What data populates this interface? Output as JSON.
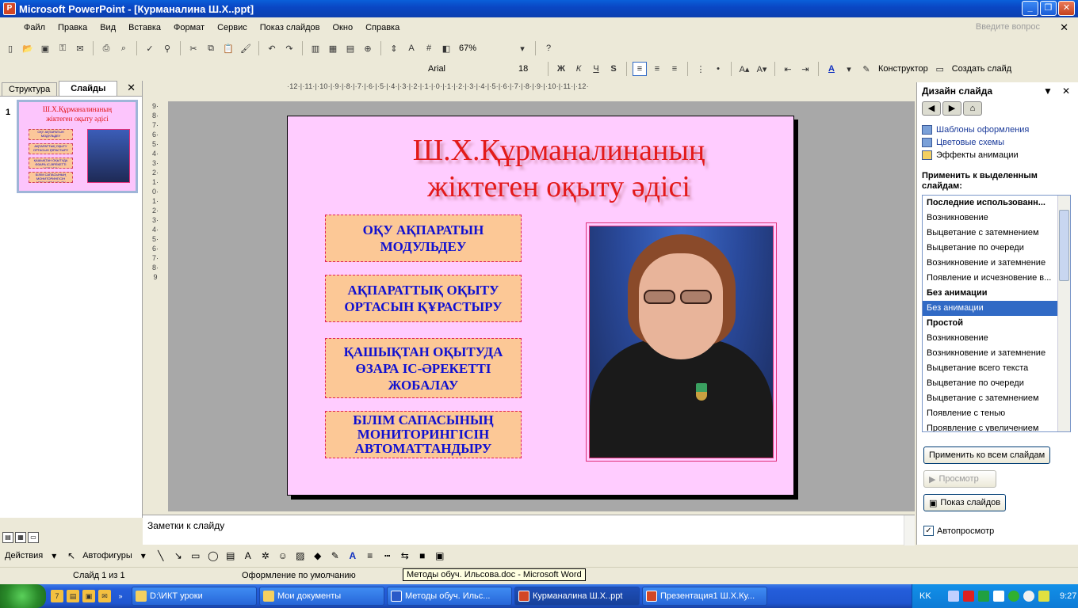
{
  "window": {
    "title": "Microsoft PowerPoint - [Курманалина Ш.Х..ppt]"
  },
  "menu": {
    "items": [
      "Файл",
      "Правка",
      "Вид",
      "Вставка",
      "Формат",
      "Сервис",
      "Показ слайдов",
      "Окно",
      "Справка"
    ],
    "help_placeholder": "Введите вопрос"
  },
  "toolbar": {
    "zoom": "67%",
    "font": "Arial",
    "size": "18",
    "bold": "Ж",
    "italic": "К",
    "underline": "Ч",
    "shadow": "S",
    "designer": "Конструктор",
    "new_slide": "Создать слайд"
  },
  "ruler": {
    "horizontal": "·12·|·11·|·10·|·9·|·8·|·7·|·6·|·5·|·4·|·3·|·2·|·1·|·0·|·1·|·2·|·3·|·4·|·5·|·6·|·7·|·8·|·9·|·10·|·11·|·12·",
    "vertical": "9·8·7·6·5·4·3·2·1·0·1·2·3·4·5·6·7·8·9"
  },
  "left_panel": {
    "tabs": [
      "Структура",
      "Слайды"
    ],
    "slide_number": "1"
  },
  "slide": {
    "title_line1": "Ш.Х.Құрманалинаның",
    "title_line2": "жіктеген оқыту әдісі",
    "boxes": [
      "ОҚУ АҚПАРАТЫН МОДУЛЬДЕУ",
      "АҚПАРАТТЫҚ ОҚЫТУ ОРТАСЫН ҚҰРАСТЫРУ",
      "ҚАШЫҚТАН ОҚЫТУДА ӨЗАРА ІС-ӘРЕКЕТТІ ЖОБАЛАУ",
      "БІЛІМ САПАСЫНЫҢ МОНИТОРИНГІСІН АВТОМАТТАНДЫРУ"
    ]
  },
  "notes": {
    "placeholder": "Заметки к слайду"
  },
  "right_panel": {
    "title": "Дизайн слайда",
    "links": [
      "Шаблоны оформления",
      "Цветовые схемы",
      "Эффекты анимации"
    ],
    "apply_label": "Применить к выделенным слайдам:",
    "animations": [
      {
        "label": "Последние использованн...",
        "type": "header"
      },
      {
        "label": "Возникновение",
        "type": "item"
      },
      {
        "label": "Выцветание с затемнением",
        "type": "item"
      },
      {
        "label": "Выцветание по очереди",
        "type": "item"
      },
      {
        "label": "Возникновение и затемнение",
        "type": "item"
      },
      {
        "label": "Появление и исчезновение в...",
        "type": "item"
      },
      {
        "label": "Без анимации",
        "type": "header"
      },
      {
        "label": "Без анимации",
        "type": "selected"
      },
      {
        "label": "Простой",
        "type": "header"
      },
      {
        "label": "Возникновение",
        "type": "item"
      },
      {
        "label": "Возникновение и затемнение",
        "type": "item"
      },
      {
        "label": "Выцветание всего текста",
        "type": "item"
      },
      {
        "label": "Выцветание по очереди",
        "type": "item"
      },
      {
        "label": "Выцветание с затемнением",
        "type": "item"
      },
      {
        "label": "Появление с тенью",
        "type": "item"
      },
      {
        "label": "Проявление с увеличением",
        "type": "item"
      }
    ],
    "apply_all": "Применить ко всем слайдам",
    "preview": "Просмотр",
    "slideshow": "Показ слайдов",
    "autopreview": "Автопросмотр"
  },
  "drawbar": {
    "actions": "Действия",
    "autoshapes": "Автофигуры"
  },
  "status": {
    "slide": "Слайд 1 из 1",
    "design": "Оформление по умолчанию",
    "tooltip": "Методы обуч.  Ильсова.doc - Microsoft Word"
  },
  "taskbar": {
    "tasks": [
      {
        "label": "D:\\ИКТ уроки",
        "kind": "folder"
      },
      {
        "label": "Мои документы",
        "kind": "folder"
      },
      {
        "label": "Методы обуч.  Ильс...",
        "kind": "word"
      },
      {
        "label": "Курманалина Ш.Х..ppt",
        "kind": "ppt"
      },
      {
        "label": "Презентация1 Ш.Х.Ку...",
        "kind": "ppt"
      }
    ],
    "lang": "KK",
    "clock": "9:27"
  }
}
